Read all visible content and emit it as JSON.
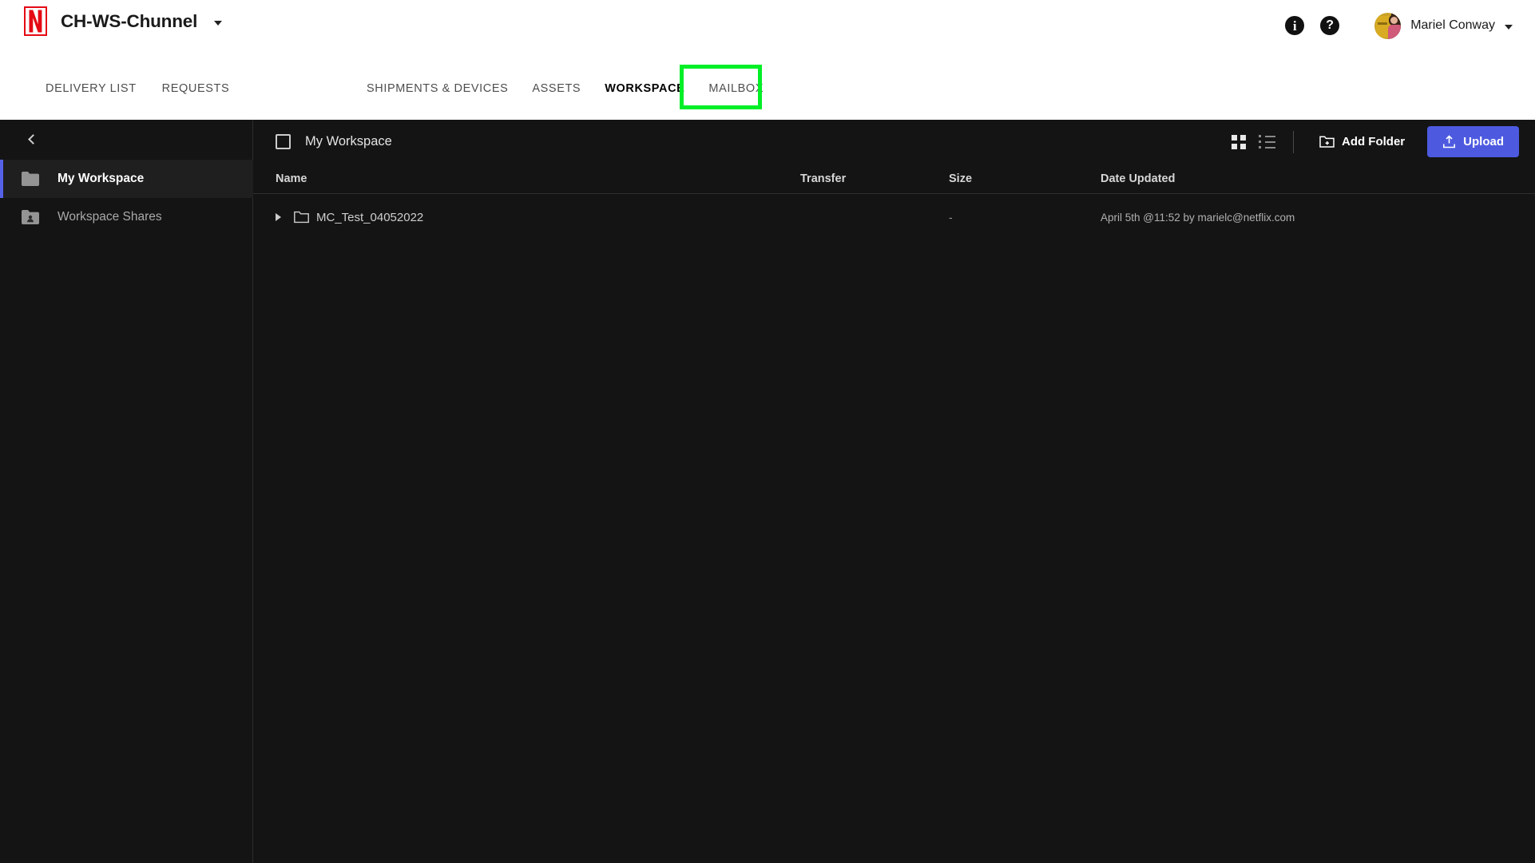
{
  "header": {
    "logo_icon": "netflix-n-logo",
    "brand": "CH-WS-Chunnel",
    "info_icon": "i",
    "help_icon": "?",
    "user_name": "Mariel Conway"
  },
  "nav": {
    "left_tabs": [
      {
        "label": "DELIVERY LIST",
        "active": false
      },
      {
        "label": "REQUESTS",
        "active": false
      }
    ],
    "center_tabs": [
      {
        "label": "SHIPMENTS & DEVICES",
        "active": false
      },
      {
        "label": "ASSETS",
        "active": false
      },
      {
        "label": "WORKSPACE",
        "active": true
      },
      {
        "label": "MAILBOX",
        "active": false
      }
    ],
    "highlight": {
      "target": "MAILBOX",
      "color": "#00ef27"
    }
  },
  "sidebar": {
    "collapse_icon": "chevron-left-icon",
    "items": [
      {
        "label": "My Workspace",
        "icon": "folder-icon",
        "active": true
      },
      {
        "label": "Workspace Shares",
        "icon": "folder-shared-icon",
        "active": false
      }
    ],
    "active_accent": "#5562e8"
  },
  "toolbar": {
    "title": "My Workspace",
    "grid_view_icon": "grid-view-icon",
    "list_view_icon": "list-view-icon",
    "add_folder_label": "Add Folder",
    "upload_label": "Upload",
    "upload_color": "#4d5ae0"
  },
  "table": {
    "columns": [
      "Name",
      "Transfer",
      "Size",
      "Date Updated"
    ],
    "rows": [
      {
        "name": "MC_Test_04052022",
        "transfer": "",
        "size": "-",
        "date": "April 5th @11:52 by marielc@netflix.com"
      }
    ]
  }
}
